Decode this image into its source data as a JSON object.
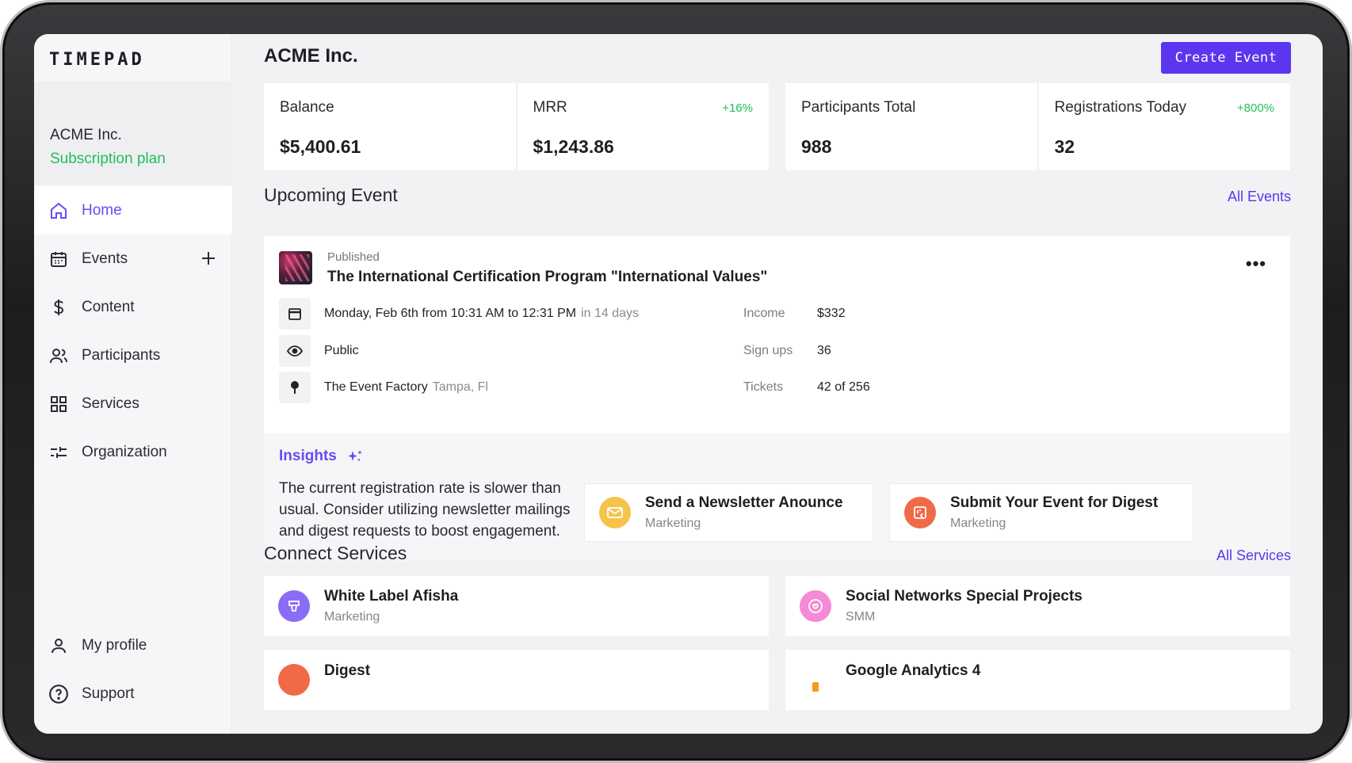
{
  "app": {
    "logo": "TIMEPAD"
  },
  "org": {
    "name": "ACME Inc.",
    "plan": "Subscription plan"
  },
  "nav": {
    "items": [
      {
        "label": "Home",
        "icon": "home-icon",
        "active": true
      },
      {
        "label": "Events",
        "icon": "calendar-icon"
      },
      {
        "label": "Content",
        "icon": "dollar-icon"
      },
      {
        "label": "Participants",
        "icon": "users-icon"
      },
      {
        "label": "Services",
        "icon": "grid-icon"
      },
      {
        "label": "Organization",
        "icon": "sliders-icon"
      }
    ],
    "bottom": [
      {
        "label": "My profile",
        "icon": "user-icon"
      },
      {
        "label": "Support",
        "icon": "help-icon"
      }
    ]
  },
  "header": {
    "title": "ACME Inc.",
    "create_label": "Create Event"
  },
  "stats": [
    {
      "label": "Balance",
      "value": "$5,400.61",
      "delta": ""
    },
    {
      "label": "MRR",
      "value": "$1,243.86",
      "delta": "+16%"
    },
    {
      "label": "Participants Total",
      "value": "988",
      "delta": ""
    },
    {
      "label": "Registrations Today",
      "value": "32",
      "delta": "+800%"
    }
  ],
  "upcoming": {
    "title": "Upcoming Event",
    "link": "All Events",
    "status": "Published",
    "name": "The International Certification Program \"International Values\"",
    "more": "•••",
    "date": "Monday, Feb 6th from 10:31 AM to 12:31 PM",
    "date_sub": "in 14 days",
    "visibility": "Public",
    "venue": "The Event Factory",
    "venue_sub": "Tampa, Fl",
    "metrics": [
      {
        "label": "Income",
        "value": "$332"
      },
      {
        "label": "Sign ups",
        "value": "36"
      },
      {
        "label": "Tickets",
        "value": "42 of 256"
      }
    ]
  },
  "insights": {
    "title": "Insights",
    "text": "The current registration rate is slower than usual. Consider utilizing newsletter mailings and digest requests to boost engagement.",
    "cards": [
      {
        "title": "Send a Newsletter Anounce",
        "sub": "Marketing",
        "color": "#f6c34a"
      },
      {
        "title": "Submit Your Event for Digest",
        "sub": "Marketing",
        "color": "#f06a48"
      }
    ]
  },
  "services": {
    "title": "Connect Services",
    "link": "All Services",
    "items": [
      {
        "title": "White Label Afisha",
        "sub": "Marketing",
        "color": "#8b6cf6"
      },
      {
        "title": "Social Networks Special Projects",
        "sub": "SMM",
        "color": "#f58ad6"
      },
      {
        "title": "Digest",
        "sub": "",
        "color": "#f06a48"
      },
      {
        "title": "Google Analytics 4",
        "sub": "",
        "color": "#f59a1a"
      }
    ]
  },
  "colors": {
    "accent": "#5b36ee",
    "positive": "#1fbf5a"
  }
}
